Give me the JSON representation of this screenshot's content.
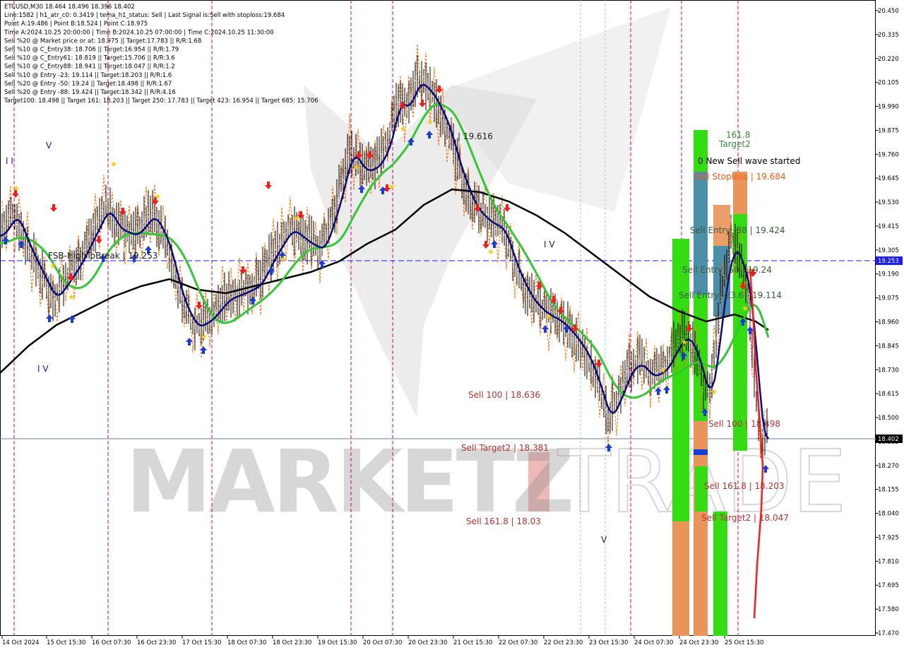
{
  "info_lines": [
    "ETCUSD,M30  18.464 18.496 18.396 18.402",
    "Line:1582  |  h1_atr_c0: 0.3419  |  tema_h1_status: Sell  |  Last Signal is:Sell with stoploss:19.684",
    "Point A:19.486  |  Point B:18.524  |  Point C:18.975",
    "Time A:2024.10.25 20:00:00  |  Time B:2024.10.25 07:00:00  |  Time C:2024.10.25 11:30:00",
    "Sell %20 @ Market price or at: 18.975  ||  Target:17.783  ||  R/R:1.68",
    "Sell %10 @ C_Entry38: 18.706  ||  Target:16.954  ||  R/R:1.79",
    "Sell %10 @ C_Entry61: 18.819  ||  Target:15.706  ||  R/R:3.6",
    "Sell %10 @ C_Entry88: 18.941  ||  Target:18.047  ||  R/R:1.2",
    "Sell %10 @ Entry -23: 19.114  ||  Target:18.203  ||  R/R:1.6",
    "Sell %20 @ Entry -50: 19.24  ||  Target:18.498  ||  R/R:1.67",
    "Sell %20 @ Entry -88: 19.424  ||  Target:18.342  ||  R/R:4.16",
    "Target100: 18.498  ||  Target 161: 18.203  ||  Target 250: 17.783  ||  Target 423: 16.954  ||  Target 685: 15.706"
  ],
  "y_axis": [
    "20.450",
    "20.335",
    "20.220",
    "20.105",
    "19.990",
    "19.875",
    "19.760",
    "19.645",
    "19.530",
    "19.415",
    "19.305",
    "19.190",
    "19.075",
    "18.960",
    "18.845",
    "18.730",
    "18.615",
    "18.500",
    "18.385",
    "18.270",
    "18.155",
    "18.040",
    "17.925",
    "17.810",
    "17.695",
    "17.580",
    "17.470"
  ],
  "x_axis": [
    "14 Oct 2024",
    "15 Oct 15:30",
    "16 Oct 07:30",
    "16 Oct 23:30",
    "17 Oct 15:30",
    "18 Oct 07:30",
    "18 Oct 23:30",
    "19 Oct 15:30",
    "20 Oct 07:30",
    "20 Oct 23:30",
    "21 Oct 15:30",
    "22 Oct 07:30",
    "22 Oct 23:30",
    "23 Oct 15:30",
    "24 Oct 07:30",
    "24 Oct 23:30",
    "25 Oct 15:30"
  ],
  "price_tags": {
    "current": "18.402",
    "hline": "19.253"
  },
  "labels": {
    "peak": "| 19.616",
    "wave_iv": "I V",
    "wave_v_left": "V",
    "wave_iv_left": "I V",
    "wave_v_bottom": "V",
    "wave_ii": "I I",
    "fsb": "FSB-HighToBreak | 19.253",
    "target2_num": "161.8",
    "target2_text": "Target2",
    "new_wave": "0 New Sell wave started",
    "stoploss": "Sell Stoploss | 19.684",
    "entry88": "Sell Entry -88 | 19.424",
    "entry50": "Sell Entry -50 | 19.24",
    "entry23": "Sell Entry -23.6 | 19.114",
    "sell100_left": "Sell 100 | 18.636",
    "sell_target2_left": "Sell Target2 | 18.381",
    "sell1618_left": "Sell 161.8 | 18.03",
    "sell100_right": "Sell 100 | 18.498",
    "sell1618_right": "Sell 161.8 | 18.203",
    "sell_target2_right": "Sell Target2 | 18.047"
  },
  "watermark": {
    "left": "MARKETZ",
    "right": "TRADE"
  },
  "colors": {
    "ema_green": "#33c833",
    "tema_navy": "#0a0a80",
    "ma_black": "#000000",
    "dashed_blue": "#1a1aff",
    "sell_red": "#c83232",
    "grid_magenta": "#c8007d",
    "entry_label": "#3a5a3a",
    "stop_label": "#ff5a14"
  }
}
